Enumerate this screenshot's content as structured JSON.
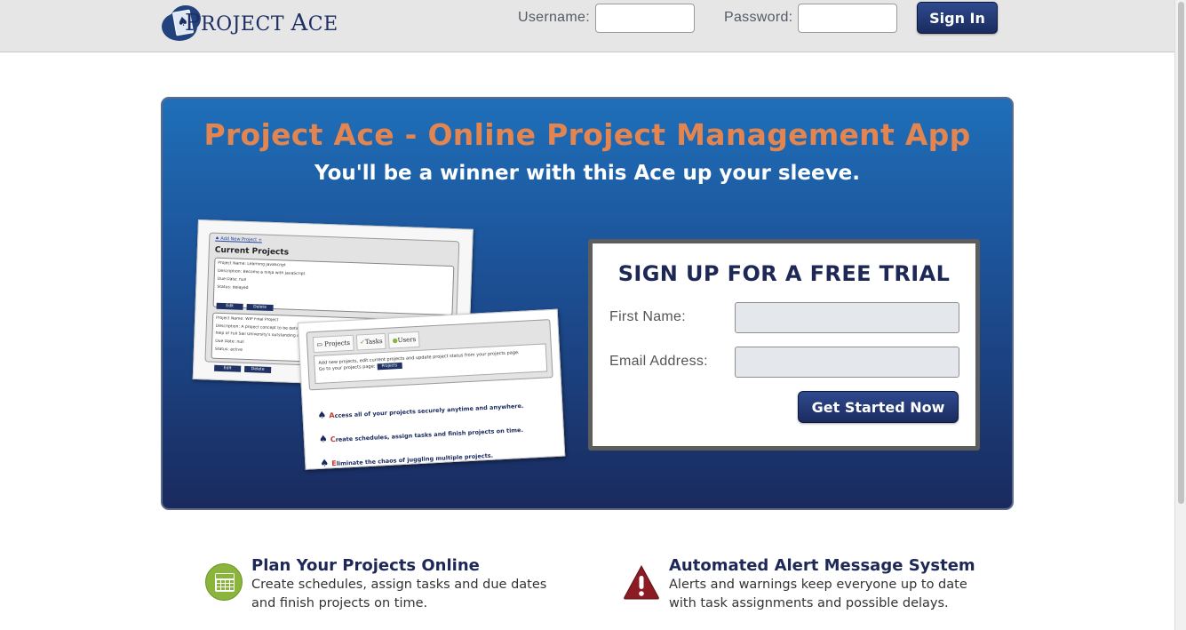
{
  "header": {
    "logo_text_1": "P",
    "logo_text_2": "ROJECT ",
    "logo_text_3": "A",
    "logo_text_4": "CE",
    "username_label": "Username:",
    "password_label": "Password:",
    "signin_label": "Sign In"
  },
  "hero": {
    "title": "Project Ace - Online Project Management App",
    "subtitle": "You'll be a winner with this Ace up your sleeve."
  },
  "screenshot_projects": {
    "add_link": "Add New Project +",
    "heading": "Current Projects",
    "cards": [
      {
        "name": "Project Name: Learning JavaScript",
        "description": "Description: Become a ninja with JavaScript.",
        "due": "Due Date: null",
        "status": "Status: delayed",
        "edit": "Edit",
        "delete": "Delete"
      },
      {
        "name": "Project Name: WIP Final Project",
        "description": "Description: A project concept to be defined and executed with Senior",
        "description_2": "help of Full Sail University's outstanding edu",
        "due": "Due Date: null",
        "status": "Status: active",
        "edit": "Edit",
        "delete": "Delete"
      }
    ]
  },
  "screenshot_tabs": {
    "tabs": [
      "Projects",
      "Tasks",
      "Users"
    ],
    "body_line_1": "Add new projects, edit current projects and update project status from your projects page.",
    "body_line_2": "Go to your projects page:",
    "body_button": "Projects",
    "bullets": [
      {
        "cap": "A",
        "rest": "ccess all of your projects securely anytime and anywhere."
      },
      {
        "cap": "C",
        "rest": "reate schedules, assign tasks and finish projects on time."
      },
      {
        "cap": "E",
        "rest": "liminate the chaos of juggling multiple projects."
      }
    ]
  },
  "signup": {
    "title": "SIGN UP FOR A FREE TRIAL",
    "first_name_label": "First Name:",
    "email_label": "Email Address:",
    "button_label": "Get Started Now"
  },
  "features": [
    {
      "title": "Plan Your Projects Online",
      "text": "Create schedules, assign tasks and due dates and finish projects on time.",
      "icon": "calendar-icon"
    },
    {
      "title": "Automated Alert Message System",
      "text": "Alerts and warnings keep everyone up to date with task assignments and possible delays.",
      "icon": "alert-icon"
    }
  ],
  "colors": {
    "brand_navy": "#1e2857",
    "hero_title_orange": "#e38550",
    "hero_blue_top": "#1f6fb9",
    "hero_blue_bottom": "#1a2a5e",
    "calendar_green": "#8ab43b",
    "alert_red": "#8b1c24"
  }
}
